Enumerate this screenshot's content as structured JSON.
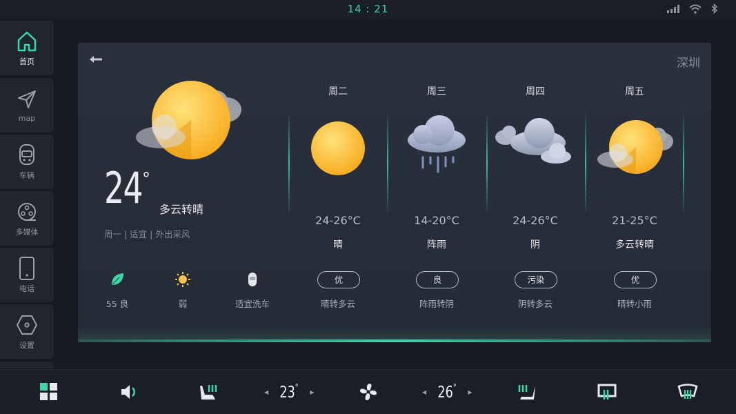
{
  "status": {
    "time": "14 : 21",
    "icons": [
      "signal-icon",
      "wifi-icon",
      "bluetooth-icon"
    ]
  },
  "sidebar": {
    "items": [
      {
        "label": "首页",
        "icon": "home-icon",
        "active": true
      },
      {
        "label": "map",
        "icon": "navigation-icon"
      },
      {
        "label": "车辆",
        "icon": "vehicle-icon"
      },
      {
        "label": "多媒体",
        "icon": "media-reel-icon"
      },
      {
        "label": "电话",
        "icon": "phone-icon"
      },
      {
        "label": "设置",
        "icon": "settings-hexagon-icon"
      }
    ]
  },
  "weather": {
    "city": "深圳",
    "today": {
      "temp": "24",
      "deg": "°",
      "condition": "多云转晴",
      "tip": "周一 | 适宜 | 外出采风",
      "metrics": [
        {
          "label": "55 良",
          "icon": "leaf-icon"
        },
        {
          "label": "弱",
          "icon": "sun-small-icon"
        },
        {
          "label": "适宜洗车",
          "icon": "car-wash-icon"
        }
      ]
    },
    "forecast": [
      {
        "day": "周二",
        "range": "24-26°C",
        "condition": "晴",
        "aqi": "优",
        "next": "晴转多云",
        "icon": "sunny-icon"
      },
      {
        "day": "周三",
        "range": "14-20°C",
        "condition": "阵雨",
        "aqi": "良",
        "next": "阵雨转阴",
        "icon": "rain-icon"
      },
      {
        "day": "周四",
        "range": "24-26°C",
        "condition": "阴",
        "aqi": "污染",
        "next": "阴转多云",
        "icon": "overcast-icon"
      },
      {
        "day": "周五",
        "range": "21-25°C",
        "condition": "多云转晴",
        "aqi": "优",
        "next": "晴转小雨",
        "icon": "partly-cloudy-icon"
      }
    ]
  },
  "dock": {
    "left_temp": "23",
    "right_temp": "26",
    "deg": "°",
    "accent": "#3ed6a6"
  }
}
